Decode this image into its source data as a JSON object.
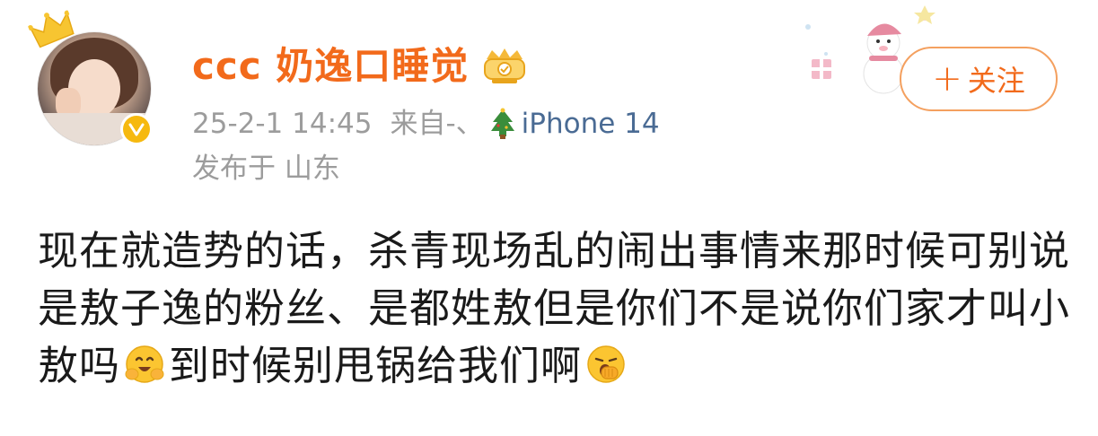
{
  "post": {
    "username": "ccc 奶逸口睡觉",
    "meta": {
      "time": "25-2-1 14:45",
      "source_prefix": "来自-、",
      "device": "iPhone 14",
      "location": "发布于 山东"
    },
    "follow_label": "关注",
    "follow_plus": "+",
    "content": {
      "part1": "现在就造势的话，杀青现场乱的闹出事情来那时候可别说是敖子逸的粉丝、是都姓敖但是你们不是说你们家才叫小敖吗",
      "part2": "到时候别甩锅给我们啊"
    }
  },
  "colors": {
    "username": "#f26a1b",
    "meta_text": "#9c9c9c",
    "device_link": "#4a6b94",
    "follow_border": "#f4a05f",
    "verified_badge": "#f6b90f"
  },
  "icons": {
    "crown": "crown-icon",
    "verified": "verified-badge-icon",
    "member": "vip-member-icon",
    "tree": "christmas-tree-icon",
    "emoji1": "hugging-face-emoji",
    "emoji2": "yawning-face-emoji"
  }
}
